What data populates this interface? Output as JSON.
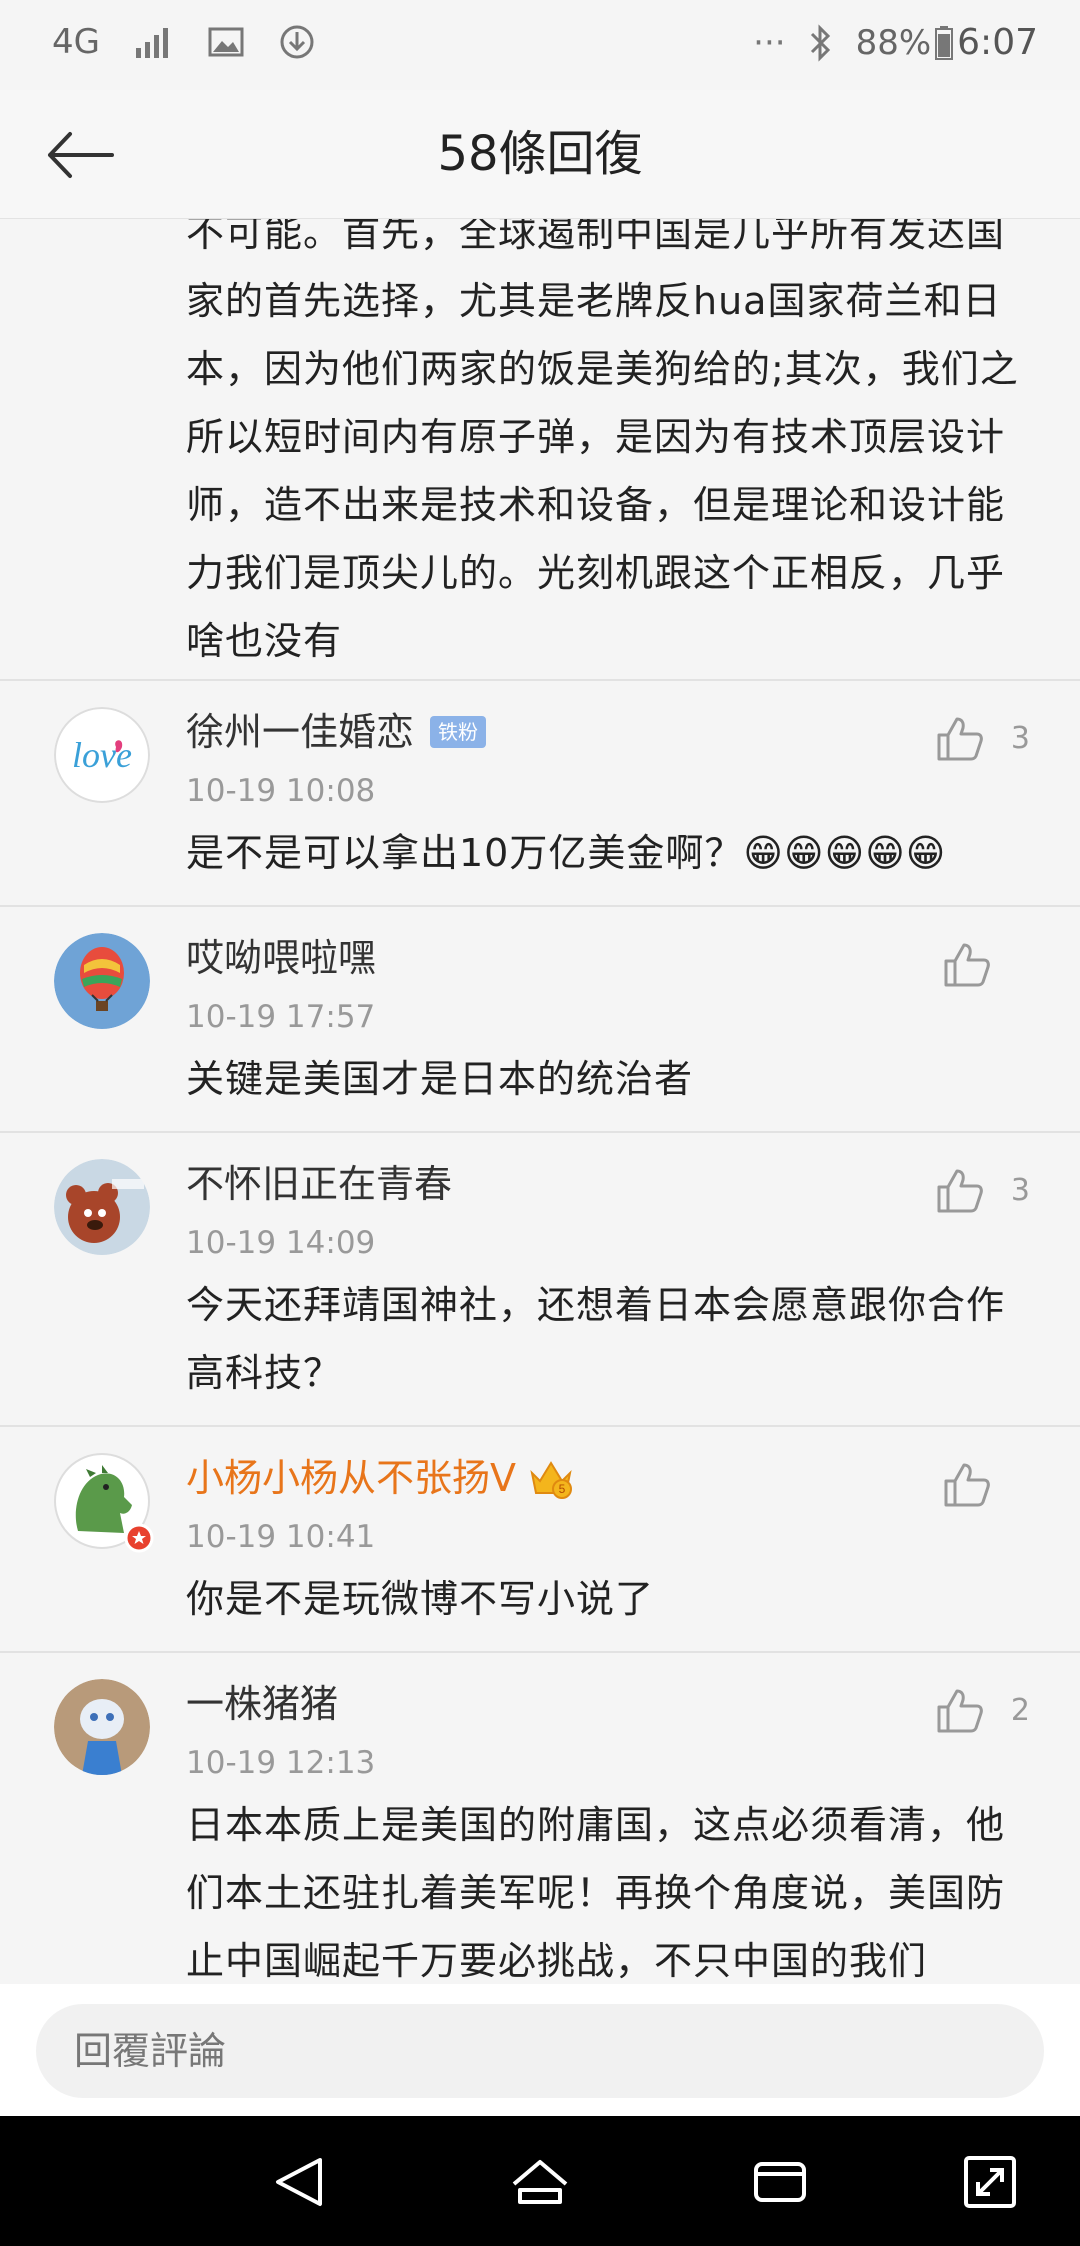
{
  "status": {
    "network": "4G",
    "battery": "88%",
    "time": "6:07"
  },
  "header": {
    "title": "58條回復"
  },
  "previous_comment_text": "不可能。首先，全球遏制中国是几乎所有发达国家的首先选择，尤其是老牌反hua国家荷兰和日本，因为他们两家的饭是美狗给的;其次，我们之所以短时间内有原子弹，是因为有技术顶层设计师，造不出来是技术和设备，但是理论和设计能力我们是顶尖儿的。光刻机跟这个正相反，几乎啥也没有",
  "comments": [
    {
      "name": "徐州一佳婚恋",
      "badge": "铁粉",
      "time": "10-19 10:08",
      "text": "是不是可以拿出10万亿美金啊？😁😁😁😁😁",
      "likes": "3"
    },
    {
      "name": "哎呦喂啦嘿",
      "time": "10-19 17:57",
      "text": "关键是美国才是日本的统治者",
      "likes": ""
    },
    {
      "name": "不怀旧正在青春",
      "time": "10-19 14:09",
      "text": "今天还拜靖国神社，还想着日本会愿意跟你合作高科技？",
      "likes": "3"
    },
    {
      "name": "小杨小杨从不张扬V",
      "time": "10-19 10:41",
      "text": "你是不是玩微博不写小说了",
      "likes": ""
    },
    {
      "name": "一株猪猪",
      "time": "10-19 12:13",
      "text": "日本本质上是美国的附庸国，这点必须看清，他们本土还驻扎着美军呢！再换个角度说，美国防止中国崛起千万要必挑战，不只中国的我们",
      "likes": "2"
    }
  ],
  "reply_bar": {
    "placeholder": "回覆評論"
  },
  "colors": {
    "vip_name": "#e8751a",
    "badge": "#8bb2e8"
  }
}
